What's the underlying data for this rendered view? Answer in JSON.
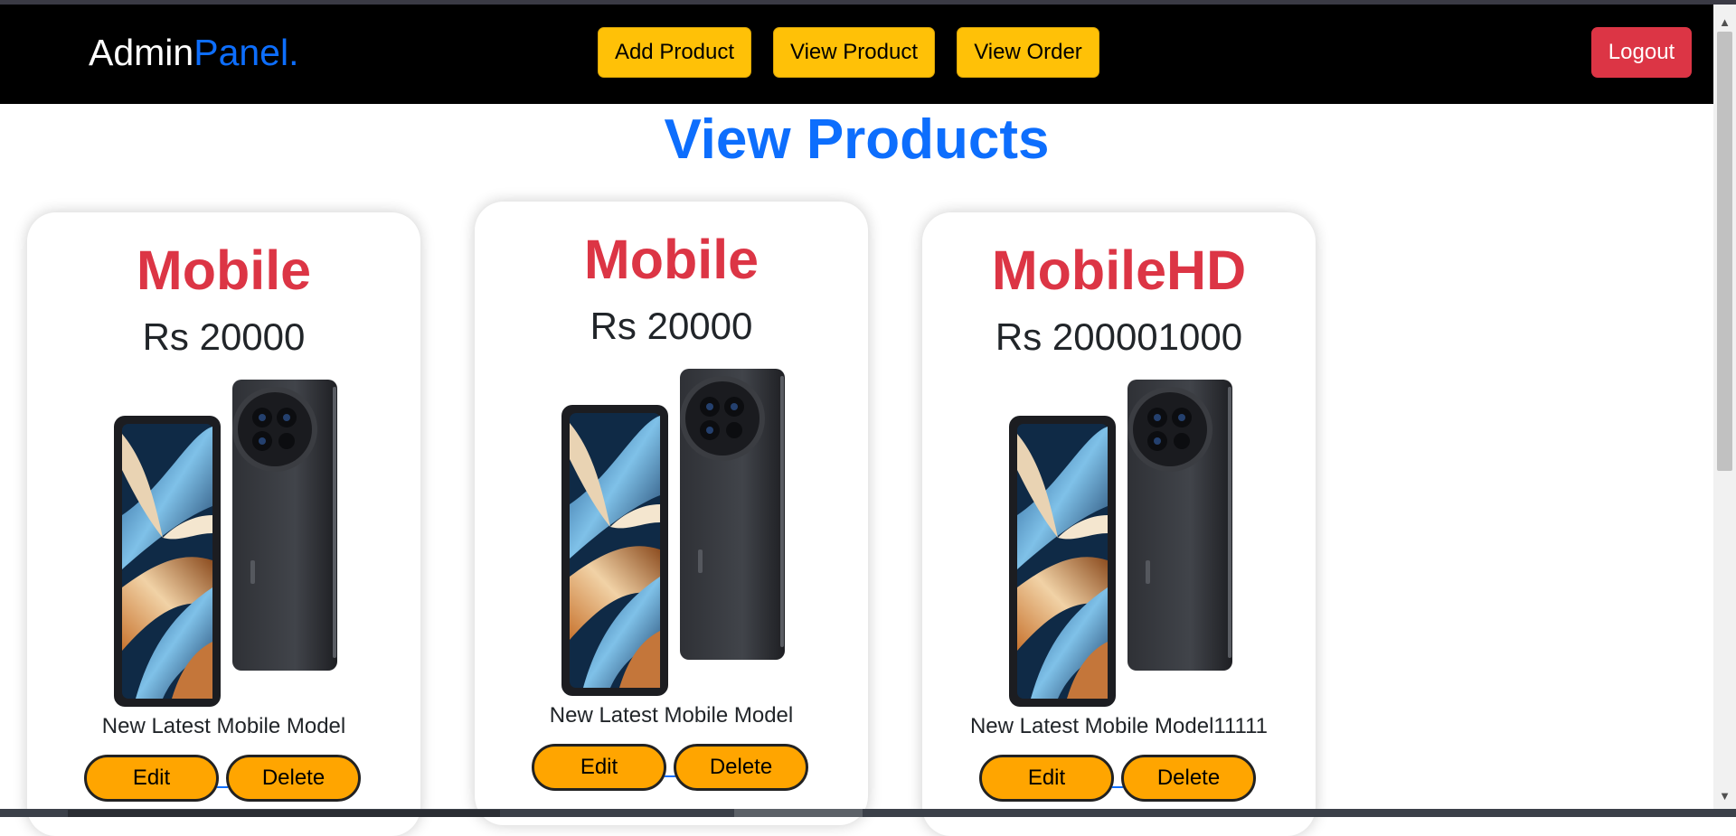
{
  "navbar": {
    "brand_main": "Admin",
    "brand_accent": "Panel.",
    "buttons": [
      "Add Product",
      "View Product",
      "View Order"
    ],
    "logout_label": "Logout"
  },
  "page": {
    "title": "View Products"
  },
  "products": [
    {
      "name": "Mobile",
      "price": "Rs 20000",
      "description": "New Latest Mobile Model",
      "edit_label": "Edit",
      "delete_label": "Delete"
    },
    {
      "name": "Mobile",
      "price": "Rs 20000",
      "description": "New Latest Mobile Model",
      "edit_label": "Edit",
      "delete_label": "Delete"
    },
    {
      "name": "MobileHD",
      "price": "Rs 200001000",
      "description": "New Latest Mobile Model11111",
      "edit_label": "Edit",
      "delete_label": "Delete"
    }
  ],
  "colors": {
    "navbar_bg": "#000000",
    "brand_accent": "#0d6efd",
    "nav_button": "#ffc107",
    "logout_button": "#dc3545",
    "title_blue": "#0d6efd",
    "product_name_red": "#dc3545",
    "card_button_orange": "#ffa500"
  },
  "icons": {
    "product_image": "phone-product-image",
    "scroll_up": "triangle-up-icon",
    "scroll_down": "triangle-down-icon"
  }
}
